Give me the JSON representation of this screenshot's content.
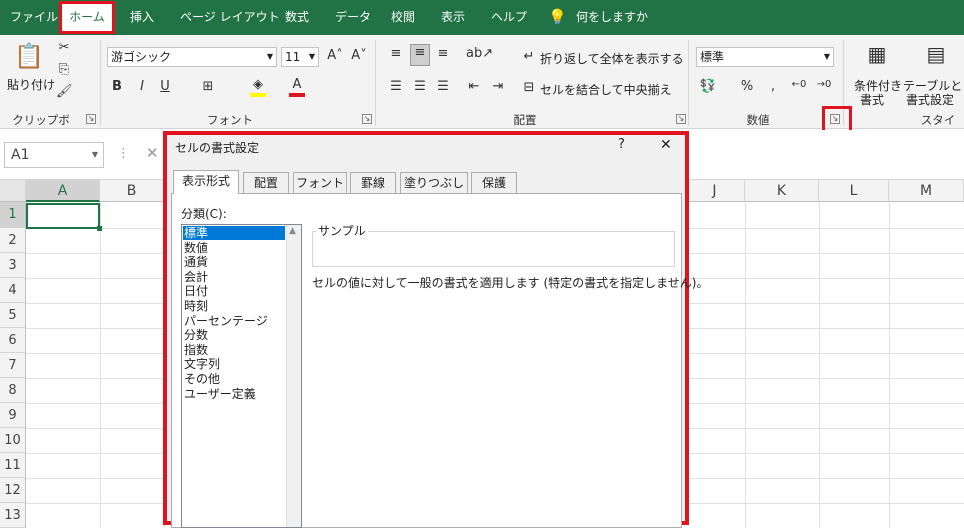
{
  "tabs": [
    "ファイル",
    "ホーム",
    "挿入",
    "ページ レイアウト",
    "数式",
    "データ",
    "校閲",
    "表示",
    "ヘルプ"
  ],
  "tell_me": "何をしますか",
  "ribbon": {
    "paste_label": "貼り付け",
    "font_name": "游ゴシック",
    "font_size": "11",
    "wrap_text": "折り返して全体を表示する",
    "merge_center": "セルを結合して中央揃え",
    "number_format": "標準",
    "cond_format_1": "条件付き",
    "cond_format_2": "書式",
    "table_format_1": "テーブルとして",
    "table_format_2": "書式設定",
    "groups": {
      "clipboard": "クリップボード",
      "font": "フォント",
      "alignment": "配置",
      "number": "数値",
      "styles": "スタイル"
    }
  },
  "formula_bar": {
    "name_box": "A1"
  },
  "sheet": {
    "columns": [
      "A",
      "B",
      "J",
      "K",
      "L",
      "M"
    ],
    "rows": [
      "1",
      "2",
      "3",
      "4",
      "5",
      "6",
      "7",
      "8",
      "9",
      "10",
      "11",
      "12",
      "13"
    ]
  },
  "dialog": {
    "title": "セルの書式設定",
    "help": "?",
    "close": "✕",
    "tabs": [
      "表示形式",
      "配置",
      "フォント",
      "罫線",
      "塗りつぶし",
      "保護"
    ],
    "category_label": "分類(C):",
    "categories": [
      "標準",
      "数値",
      "通貨",
      "会計",
      "日付",
      "時刻",
      "パーセンテージ",
      "分数",
      "指数",
      "文字列",
      "その他",
      "ユーザー定義"
    ],
    "sample_label": "サンプル",
    "description": "セルの値に対して一般の書式を適用します (特定の書式を指定しません)。"
  },
  "colors": {
    "excel_green": "#217346",
    "highlight": "#e0141e",
    "selection": "#0078d7"
  }
}
